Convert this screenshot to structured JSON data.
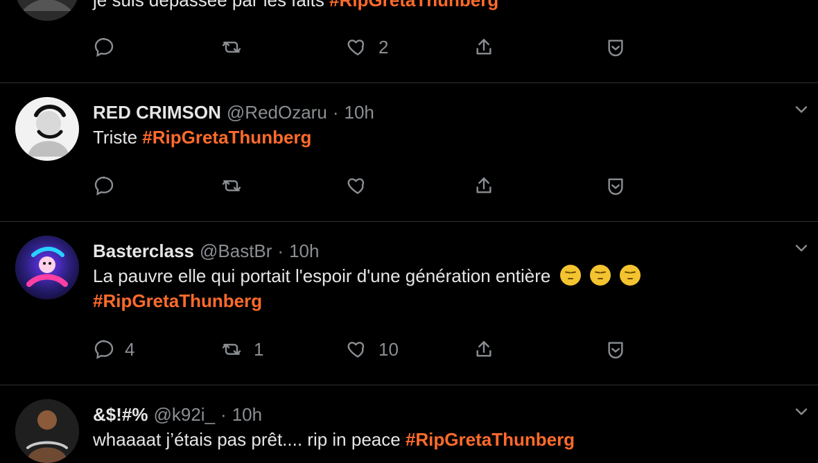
{
  "colors": {
    "background": "#000000",
    "text": "#e6e6e6",
    "muted": "#8b8f93",
    "hashtag": "#ff6b2b",
    "divider": "#2f3336"
  },
  "tweets": [
    {
      "partial_text": "je suis dépassée par les faits",
      "hashtag": "#RipGretaThunberg",
      "actions": {
        "reply_count": "",
        "retweet_count": "",
        "like_count": "2"
      }
    },
    {
      "name": "RED CRIMSON",
      "handle": "@RedOzaru",
      "time": "10h",
      "text": "Triste",
      "hashtag": "#RipGretaThunberg",
      "actions": {
        "reply_count": "",
        "retweet_count": "",
        "like_count": ""
      }
    },
    {
      "name": "Basterclass",
      "handle": "@BastBr",
      "time": "10h",
      "text": "La pauvre elle qui portait l'espoir d'une génération entière",
      "emoji": "pensive-face",
      "hashtag": "#RipGretaThunberg",
      "actions": {
        "reply_count": "4",
        "retweet_count": "1",
        "like_count": "10"
      }
    },
    {
      "name": "&$!#%",
      "handle": "@k92i_",
      "time": "10h",
      "text": "whaaaat j’étais pas prêt.... rip in peace",
      "hashtag": "#RipGretaThunberg"
    }
  ],
  "icons": {
    "reply": "reply-icon",
    "retweet": "retweet-icon",
    "like": "heart-icon",
    "share": "share-icon",
    "bookmark": "bookmark-icon",
    "more": "chevron-down-icon"
  }
}
